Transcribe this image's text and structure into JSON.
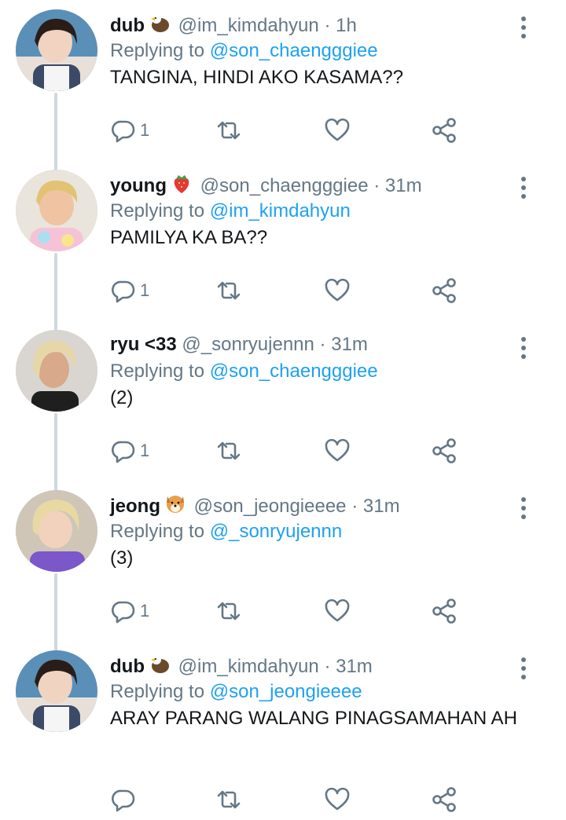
{
  "replying_label": "Replying to",
  "tweets": [
    {
      "name": "dub",
      "emoji": "eagle-emoji",
      "handle": "@im_kimdahyun",
      "sep": "·",
      "time": "1h",
      "reply_to": "@son_chaengggiee",
      "text": "TANGINA, HINDI AKO KASAMA??",
      "reply_count": "1",
      "avatar": "avatar-dahyun"
    },
    {
      "name": "young",
      "emoji": "strawberry-emoji",
      "handle": "@son_chaengggiee",
      "sep": "·",
      "time": "31m",
      "reply_to": "@im_kimdahyun",
      "text": "PAMILYA KA BA??",
      "reply_count": "1",
      "avatar": "avatar-chaeyoung"
    },
    {
      "name": "ryu <33",
      "emoji": "",
      "handle": "@_sonryujennn",
      "sep": "·",
      "time": "31m",
      "reply_to": "@son_chaengggiee",
      "text": "(2)",
      "reply_count": "1",
      "avatar": "avatar-jennie"
    },
    {
      "name": "jeong",
      "emoji": "dog-emoji",
      "handle": "@son_jeongieeee",
      "sep": "·",
      "time": "31m",
      "reply_to": "@_sonryujennn",
      "text": "(3)",
      "reply_count": "1",
      "avatar": "avatar-jeongyeon"
    },
    {
      "name": "dub",
      "emoji": "eagle-emoji",
      "handle": "@im_kimdahyun",
      "sep": "·",
      "time": "31m",
      "reply_to": "@son_jeongieeee",
      "text": "ARAY PARANG WALANG PINAGSAMAHAN AH",
      "reply_count": "",
      "avatar": "avatar-dahyun"
    }
  ],
  "colors": {
    "accent": "#1da1f2",
    "muted": "#657786",
    "text": "#14171a",
    "thread_line": "#cfd9de"
  }
}
